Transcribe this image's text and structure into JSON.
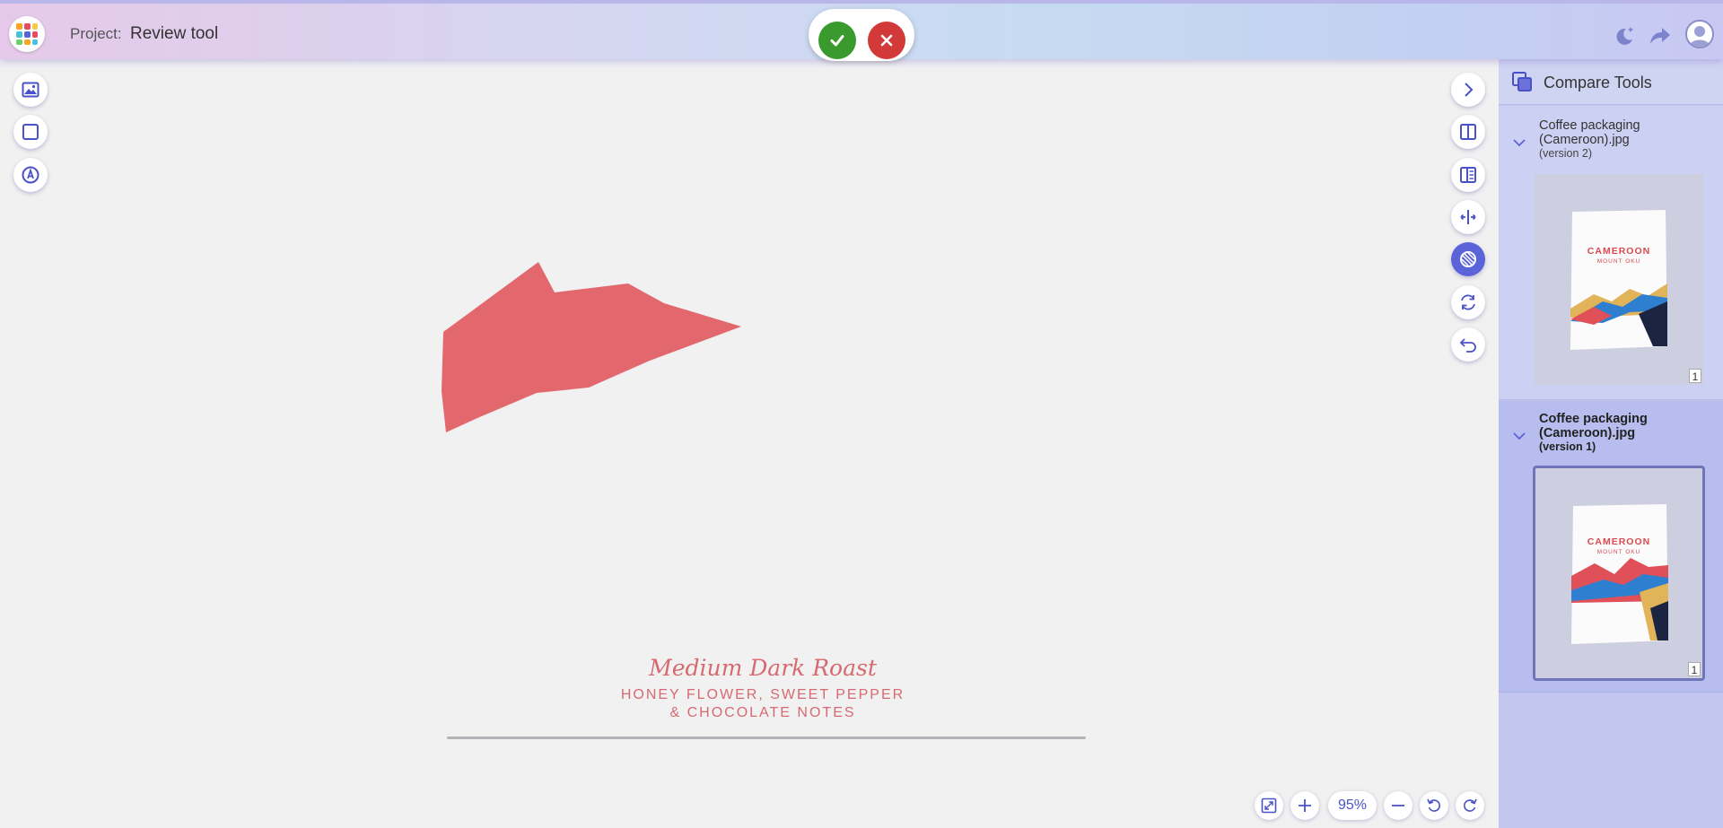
{
  "header": {
    "project_label": "Project:",
    "project_name": "Review tool",
    "approve_icon": "check-icon",
    "reject_icon": "close-icon",
    "right_icons": [
      "moon-stars-icon",
      "share-arrow-icon",
      "user-avatar-icon"
    ]
  },
  "left_tools": [
    "image-icon",
    "square-icon",
    "pen-circle-icon"
  ],
  "right_tools": [
    "chevron-right-icon",
    "split-view-icon",
    "side-by-side-icon",
    "swipe-compare-icon",
    "overlay-compare-icon",
    "sync-icon",
    "undo-icon"
  ],
  "artwork": {
    "line1": "Medium Dark Roast",
    "line2": "HONEY FLOWER, SWEET PEPPER",
    "line3": "& CHOCOLATE NOTES"
  },
  "zoom": {
    "value": "95%"
  },
  "panel": {
    "title": "Compare Tools",
    "versions": [
      {
        "name": "Coffee packaging (Cameroon).jpg",
        "version": "(version 2)",
        "page": "1",
        "bag_title": "CAMEROON",
        "bag_sub": "MOUNT OKU"
      },
      {
        "name": "Coffee packaging (Cameroon).jpg",
        "version": "(version 1)",
        "page": "1",
        "bag_title": "CAMEROON",
        "bag_sub": "MOUNT OKU"
      }
    ]
  },
  "colors": {
    "accent": "#4a52c7",
    "approve": "#3a9a2e",
    "reject": "#d23a3a",
    "artwork_red": "#e06065"
  }
}
